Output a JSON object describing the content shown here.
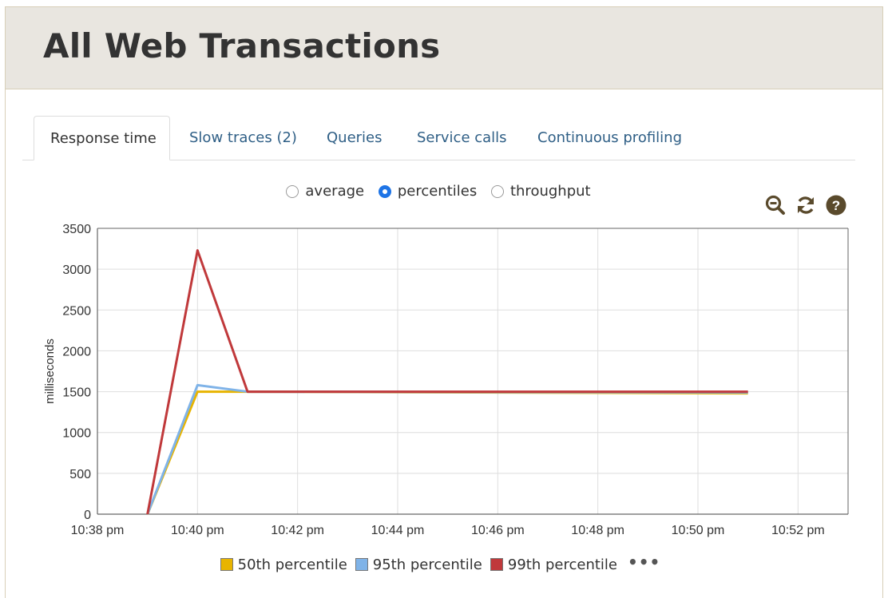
{
  "page": {
    "title": "All Web Transactions"
  },
  "tabs": [
    {
      "label": "Response time",
      "active": true
    },
    {
      "label": "Slow traces (2)",
      "active": false
    },
    {
      "label": "Queries",
      "active": false
    },
    {
      "label": "Service calls",
      "active": false
    },
    {
      "label": "Continuous profiling",
      "active": false
    }
  ],
  "view_options": [
    {
      "label": "average",
      "checked": false
    },
    {
      "label": "percentiles",
      "checked": true
    },
    {
      "label": "throughput",
      "checked": false
    }
  ],
  "toolbar": {
    "icons": [
      "zoom-out-icon",
      "refresh-icon",
      "help-icon"
    ],
    "color": "#5a4a2c"
  },
  "colors": {
    "accent": "#1e74e6",
    "header_bg": "#e9e6e0",
    "link": "#2f5f86"
  },
  "chart_data": {
    "type": "line",
    "ylabel": "milliseconds",
    "xlabel": "",
    "ylim": [
      0,
      3500
    ],
    "yticks": [
      0,
      500,
      1000,
      1500,
      2000,
      2500,
      3000,
      3500
    ],
    "xlim_minutes": [
      0,
      15
    ],
    "xticks": [
      {
        "t": 0,
        "label": "10:38 pm"
      },
      {
        "t": 2,
        "label": "10:40 pm"
      },
      {
        "t": 4,
        "label": "10:42 pm"
      },
      {
        "t": 6,
        "label": "10:44 pm"
      },
      {
        "t": 8,
        "label": "10:46 pm"
      },
      {
        "t": 10,
        "label": "10:48 pm"
      },
      {
        "t": 12,
        "label": "10:50 pm"
      },
      {
        "t": 14,
        "label": "10:52 pm"
      }
    ],
    "grid": true,
    "legend_position": "bottom",
    "series": [
      {
        "name": "50th percentile",
        "color": "#e8b400",
        "points": [
          {
            "x": "10:39 pm",
            "y": 0
          },
          {
            "x": "10:40 pm",
            "y": 1500
          },
          {
            "x": "10:41 pm",
            "y": 1500
          },
          {
            "x": "10:51 pm",
            "y": 1480
          }
        ]
      },
      {
        "name": "95th percentile",
        "color": "#7fb3e8",
        "points": [
          {
            "x": "10:39 pm",
            "y": 0
          },
          {
            "x": "10:40 pm",
            "y": 1580
          },
          {
            "x": "10:41 pm",
            "y": 1500
          },
          {
            "x": "10:51 pm",
            "y": 1490
          }
        ]
      },
      {
        "name": "99th percentile",
        "color": "#c0393b",
        "points": [
          {
            "x": "10:39 pm",
            "y": 0
          },
          {
            "x": "10:40 pm",
            "y": 3230
          },
          {
            "x": "10:41 pm",
            "y": 1500
          },
          {
            "x": "10:51 pm",
            "y": 1500
          }
        ]
      }
    ],
    "legend_more": "•••"
  }
}
